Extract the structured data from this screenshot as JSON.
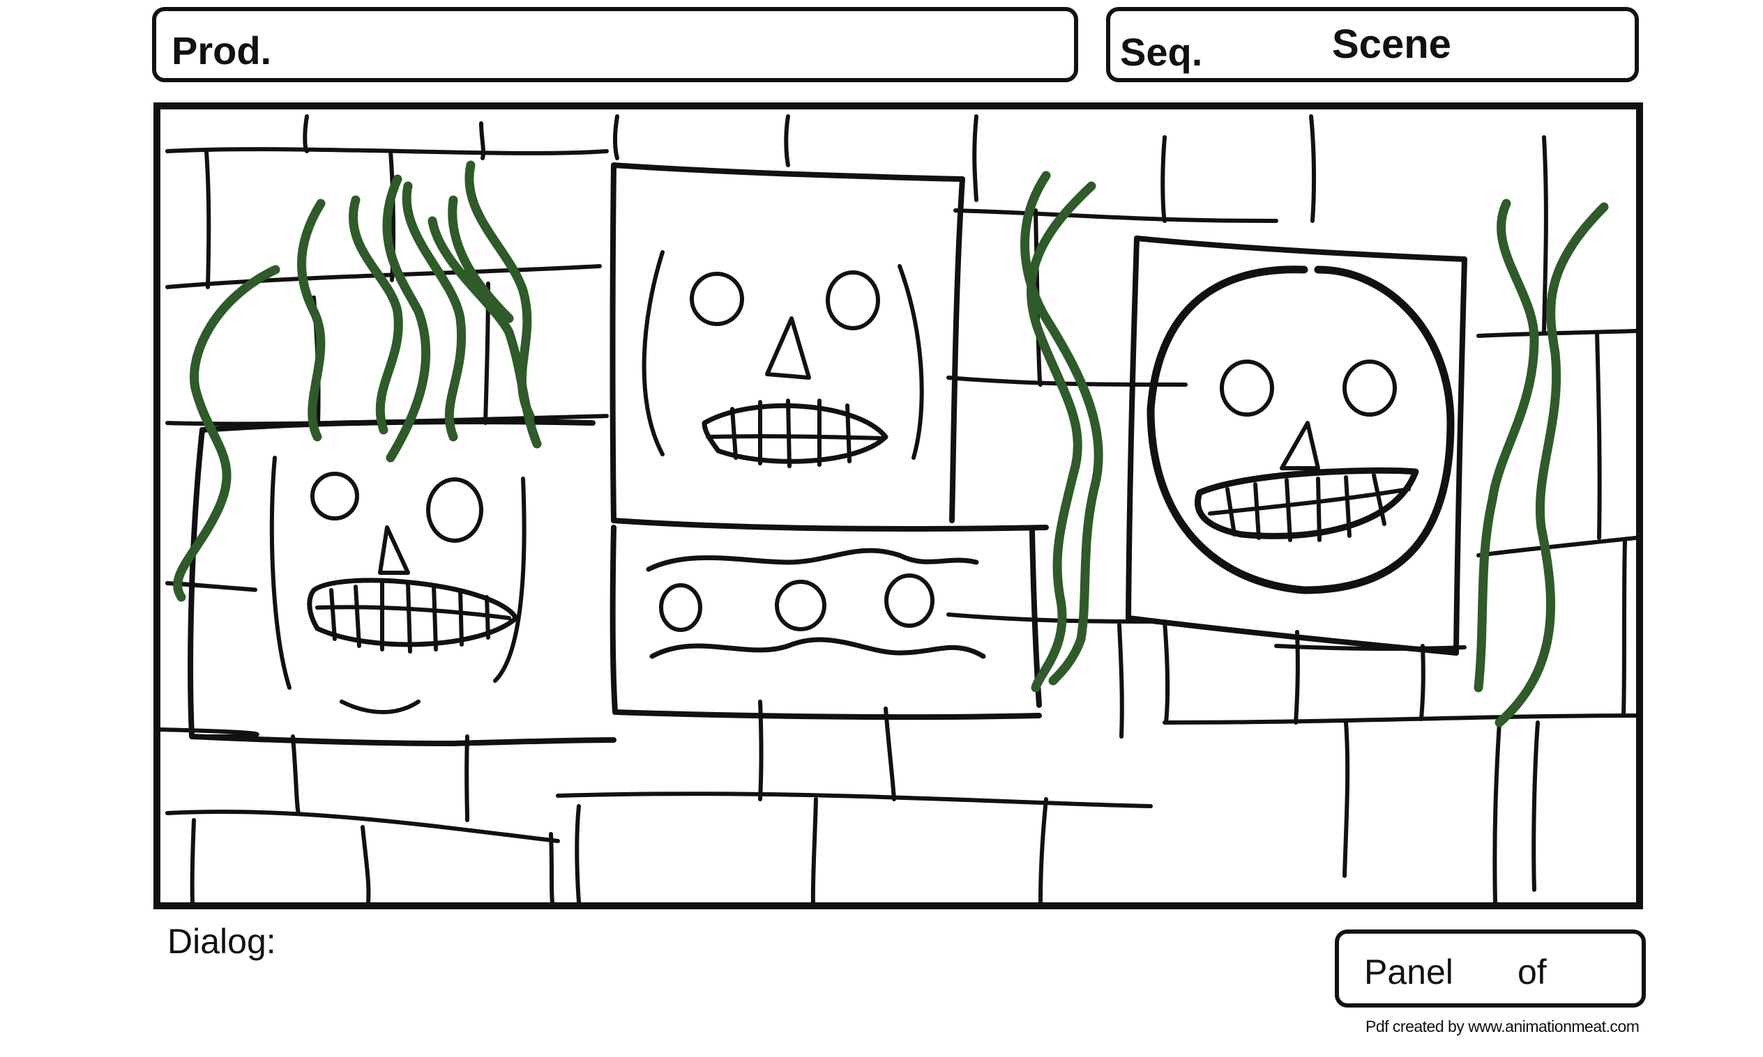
{
  "header": {
    "production_label": "Prod.",
    "sequence_label": "Seq.",
    "scene_label": "Scene"
  },
  "panel_drawing": {
    "stroke_color": "#111111",
    "seaweed_color": "#2f5a2a",
    "background_color": "#ffffff"
  },
  "footer": {
    "dialog_label": "Dialog:",
    "panel_label": "Panel",
    "of_label": "of",
    "credit": "Pdf created by www.animationmeat.com"
  }
}
